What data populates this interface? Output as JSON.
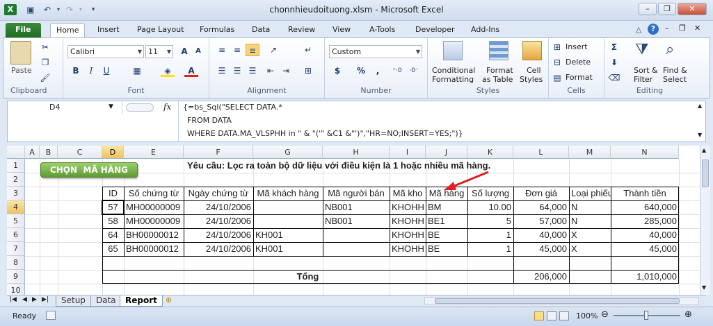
{
  "window": {
    "title": "chonnhieudoituong.xlsm - Microsoft Excel"
  },
  "tabs": [
    "File",
    "Home",
    "Insert",
    "Page Layout",
    "Formulas",
    "Data",
    "Review",
    "View",
    "A-Tools",
    "Developer",
    "Add-Ins"
  ],
  "ribbon": {
    "clipboard": {
      "label": "Clipboard",
      "paste": "Paste"
    },
    "font": {
      "label": "Font",
      "name": "Calibri",
      "size": "11"
    },
    "alignment": {
      "label": "Alignment"
    },
    "number": {
      "label": "Number",
      "format": "Custom",
      "currency": "$",
      "percent": "%",
      "comma": ","
    },
    "styles": {
      "label": "Styles",
      "cond1": "Conditional",
      "cond2": "Formatting",
      "fmt1": "Format",
      "fmt2": "as Table",
      "cell1": "Cell",
      "cell2": "Styles"
    },
    "cells": {
      "label": "Cells",
      "insert": "Insert",
      "delete": "Delete",
      "format": "Format"
    },
    "editing": {
      "label": "Editing",
      "sort1": "Sort &",
      "sort2": "Filter",
      "find1": "Find &",
      "find2": "Select"
    }
  },
  "formula_bar": {
    "name_box": "D4",
    "fx": "fx",
    "line1": "{=bs_Sql(\"SELECT DATA.*",
    "line2": "FROM DATA",
    "line3": "WHERE DATA.MA_VLSPHH in \" & \"('\" &C1 &\"')\",\"HR=NO;INSERT=YES;\")}"
  },
  "sheet": {
    "columns": [
      "A",
      "B",
      "C",
      "D",
      "E",
      "F",
      "G",
      "H",
      "I",
      "J",
      "K",
      "L",
      "M",
      "N"
    ],
    "rows": [
      "1",
      "2",
      "3",
      "4",
      "5",
      "6",
      "7",
      "8",
      "9",
      "10"
    ],
    "button_label": "CHỌN  MÃ HÀNG",
    "requirement": "Yêu cầu: Lọc ra toàn bộ dữ liệu với điều kiện là 1 hoặc nhiều mã hàng.",
    "headers": [
      "ID",
      "Số chứng từ",
      "Ngày chứng từ",
      "Mã khách hàng",
      "Mã người bán",
      "Mã kho",
      "Mã hàng",
      "Số lượng",
      "Đơn giá",
      "Loại phiếu",
      "Thành tiền"
    ],
    "data": [
      [
        "57",
        "MH00000009",
        "24/10/2006",
        "",
        "NB001",
        "KHOHH",
        "BM",
        "10.00",
        "64,000",
        "N",
        "640,000"
      ],
      [
        "58",
        "MH00000009",
        "24/10/2006",
        "",
        "NB001",
        "KHOHH",
        "BE1",
        "5",
        "57,000",
        "N",
        "285,000"
      ],
      [
        "64",
        "BH00000012",
        "24/10/2006",
        "KH001",
        "",
        "KHOHH",
        "BE",
        "1",
        "40,000",
        "X",
        "40,000"
      ],
      [
        "65",
        "BH00000012",
        "24/10/2006",
        "KH001",
        "",
        "KHOHH",
        "BE",
        "1",
        "45,000",
        "X",
        "45,000"
      ]
    ],
    "total_label": "Tổng",
    "total_price": "206,000",
    "total_amount": "1,010,000"
  },
  "sheet_tabs": [
    "Setup",
    "Data",
    "Report"
  ],
  "status": {
    "ready": "Ready",
    "zoom": "100%"
  },
  "colors": {
    "file_tab": "#1f6e22",
    "button": "#7ab648",
    "arrow": "#e02020",
    "selection": "#f1c15f"
  }
}
